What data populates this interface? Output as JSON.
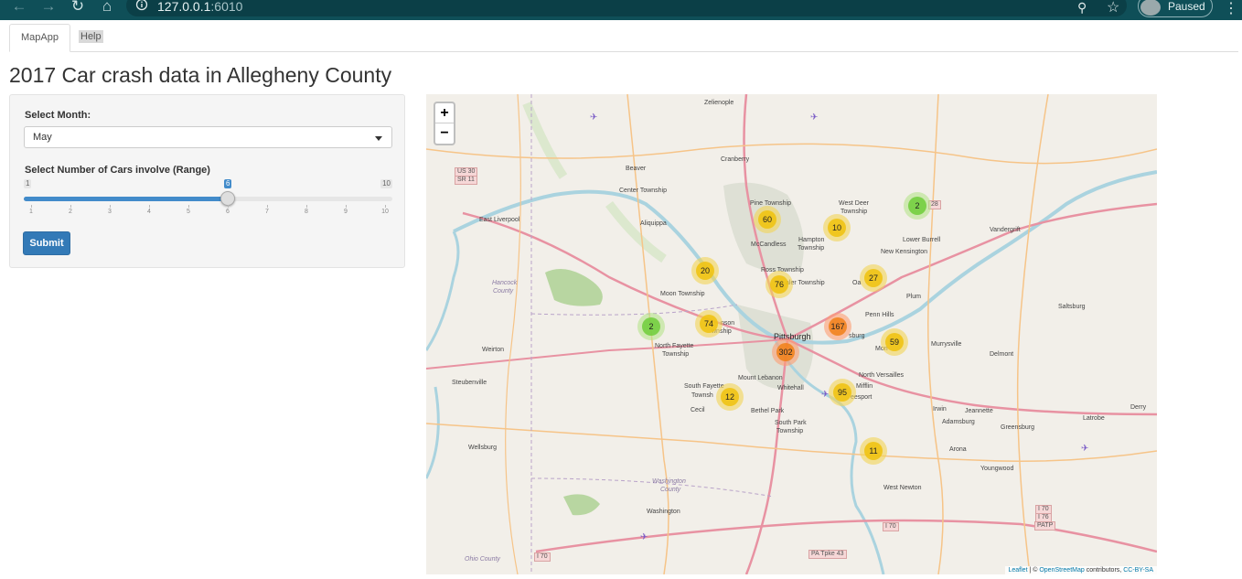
{
  "browser": {
    "url_host": "127.0.0.1",
    "url_port": ":6010",
    "profile_label": "Paused"
  },
  "tabs": [
    {
      "label": "MapApp"
    },
    {
      "label": "Help"
    }
  ],
  "page_title": "2017 Car crash data in Allegheny County",
  "sidebar": {
    "month_label": "Select Month:",
    "month_value": "May",
    "cars_label": "Select Number of Cars involve (Range)",
    "slider": {
      "min": 1,
      "max": 10,
      "value": 6,
      "ticks": [
        1,
        2,
        3,
        4,
        5,
        6,
        7,
        8,
        9,
        10
      ]
    },
    "submit_label": "Submit"
  },
  "map": {
    "zoom_in": "+",
    "zoom_out": "−",
    "clusters": [
      {
        "count": "60",
        "size": "med"
      },
      {
        "count": "10",
        "size": "med"
      },
      {
        "count": "2",
        "size": "small"
      },
      {
        "count": "20",
        "size": "med"
      },
      {
        "count": "76",
        "size": "med"
      },
      {
        "count": "27",
        "size": "med"
      },
      {
        "count": "2",
        "size": "small"
      },
      {
        "count": "74",
        "size": "med"
      },
      {
        "count": "167",
        "size": "large"
      },
      {
        "count": "59",
        "size": "med"
      },
      {
        "count": "302",
        "size": "large"
      },
      {
        "count": "95",
        "size": "med"
      },
      {
        "count": "12",
        "size": "med"
      },
      {
        "count": "11",
        "size": "med"
      }
    ],
    "places": {
      "zelienople": "Zelienople",
      "cranberry": "Cranberry",
      "beaver": "Beaver",
      "center_twp": "Center Township",
      "aliquippa": "Aliquippa",
      "east_liverpool": "East Liverpool",
      "pine_twp": "Pine Township",
      "west_deer": "West Deer",
      "west_deer_2": "Township",
      "mccandless": "McCandless",
      "hampton": "Hampton",
      "hampton_2": "Township",
      "lower_burrell": "Lower Burrell",
      "new_kensington": "New Kensington",
      "vandergrift": "Vandergrift",
      "ross": "Ross Township",
      "shaler": "aler Township",
      "oakmont": "Oa",
      "plum": "Plum",
      "moon": "Moon Township",
      "hancock": "Hancock",
      "hancock_2": "County",
      "robinson": "nson",
      "robinson_2": "wnship",
      "pittsburgh": "Pittsburgh",
      "penn_hills": "Penn Hills",
      "wilkinsburg": "sburg",
      "monroeville": "Mon",
      "murrysville": "Murrysville",
      "saltsburg": "Saltsburg",
      "delmont": "Delmont",
      "north_fayette": "North Fayette",
      "north_fayette_2": "Township",
      "weirton": "Weirton",
      "mt_lebanon": "Mount Lebanon",
      "whitehall": "Whitehall",
      "north_versailles": "North Versailles",
      "mifflin": "Mifflin",
      "mckeesport": "eesport",
      "south_fayette": "South Fayette",
      "south_fayette_2": "Townsh",
      "steubenville": "Steubenville",
      "irwin": "Irwin",
      "jeannette": "Jeannette",
      "adamsburg": "Adamsburg",
      "greensburg": "Greensburg",
      "derry": "Derry",
      "latrobe": "Latrobe",
      "cecil": "Cecil",
      "bethel_park": "Bethel Park",
      "south_park": "South Park",
      "south_park_2": "Township",
      "wellsburg": "Wellsburg",
      "arona": "Arona",
      "youngwood": "Youngwood",
      "washington_county": "Washington",
      "washington_county_2": "County",
      "west_newton": "West Newton",
      "washington": "Washington",
      "ohio_county": "Ohio County"
    },
    "shields": {
      "us30": "US 30",
      "sr11": "SR 11",
      "r28": "28",
      "i70_a": "I 70",
      "i70_b": "I 70",
      "pa_tpke": "PA Tpke 43",
      "i70_c": "I 70",
      "i76": "I 76",
      "patp": "PATP"
    },
    "attribution": {
      "leaflet": "Leaflet",
      "sep": " | © ",
      "osm": "OpenStreetMap",
      "contrib": " contributors, ",
      "license": "CC-BY-SA"
    }
  }
}
